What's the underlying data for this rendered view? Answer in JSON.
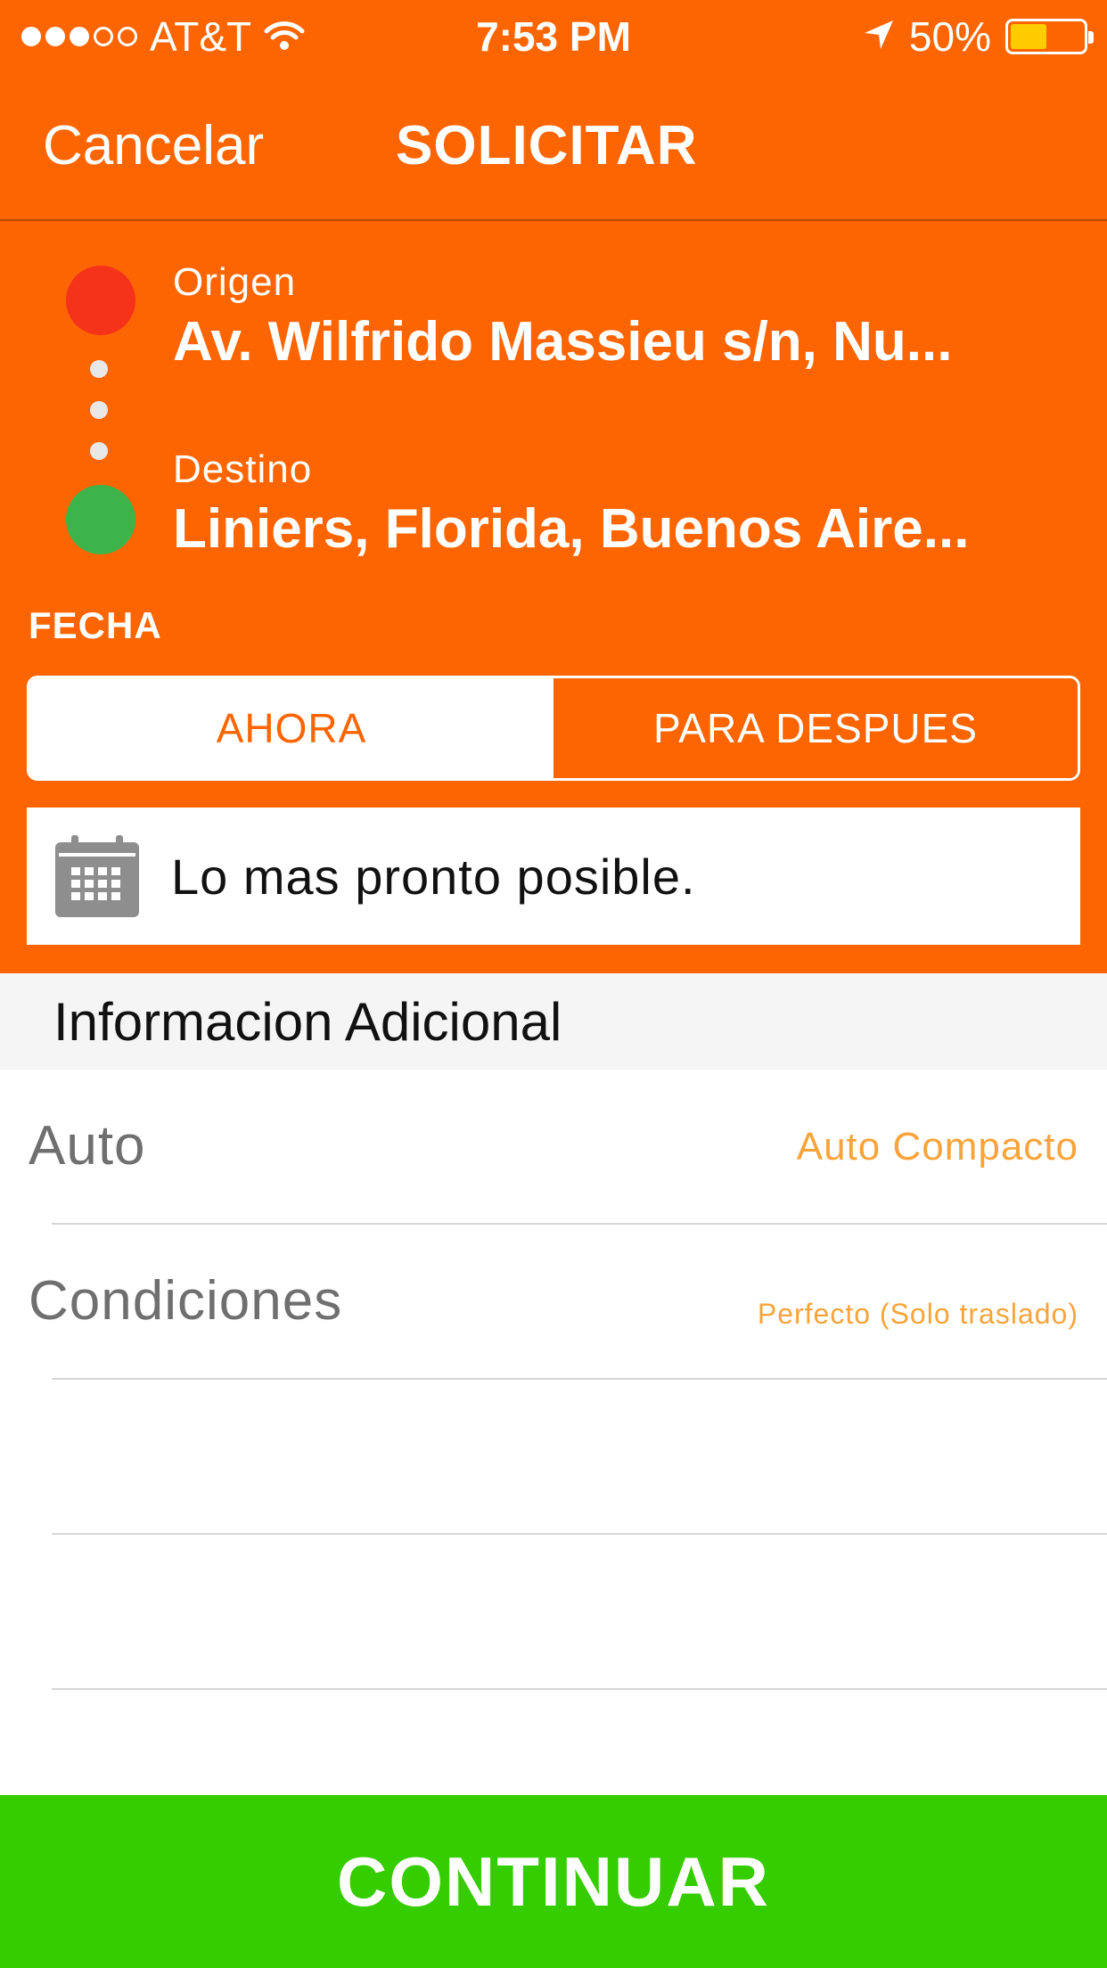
{
  "status_bar": {
    "carrier": "AT&T",
    "time": "7:53 PM",
    "battery": "50%",
    "battery_level": 0.5,
    "icons": [
      "signal-dots-icon",
      "wifi-icon",
      "location-arrow-icon",
      "battery-icon"
    ]
  },
  "nav": {
    "cancel_label": "Cancelar",
    "title": "SOLICITAR"
  },
  "route": {
    "origin_label": "Origen",
    "origin_value": "Av. Wilfrido Massieu s/n, Nu...",
    "destination_label": "Destino",
    "destination_value": "Liniers, Florida, Buenos Aire...",
    "colors": {
      "origin": "#F5321A",
      "destination": "#3CB44A"
    }
  },
  "fecha": {
    "label": "FECHA",
    "options": [
      "AHORA",
      "PARA DESPUES"
    ],
    "selected": "AHORA",
    "date_text": "Lo mas pronto posible.",
    "icon": "calendar-icon"
  },
  "additional": {
    "header": "Informacion Adicional",
    "rows": [
      {
        "label": "Auto",
        "value": "Auto Compacto"
      },
      {
        "label": "Condiciones",
        "value": "Perfecto (Solo traslado)"
      },
      {
        "label": "",
        "value": ""
      },
      {
        "label": "",
        "value": ""
      }
    ]
  },
  "continue_label": "CONTINUAR",
  "colors": {
    "primary": "#FD6502",
    "accent_value": "#F8A43A",
    "continue": "#35CC00"
  }
}
